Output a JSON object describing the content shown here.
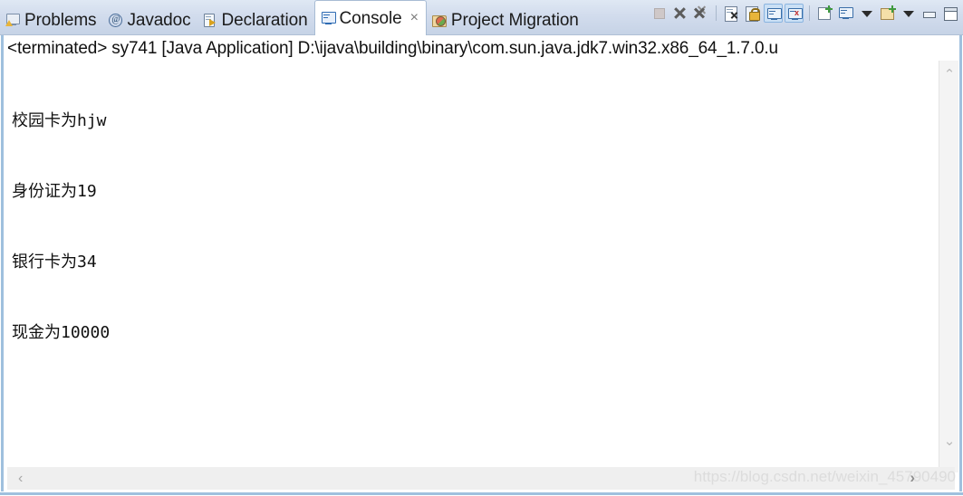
{
  "view": {
    "name": "Eclipse Console View"
  },
  "tabs": [
    {
      "label": "Problems",
      "icon": "problems-icon",
      "active": false,
      "closable": false
    },
    {
      "label": "Javadoc",
      "icon": "javadoc-icon",
      "active": false,
      "closable": false
    },
    {
      "label": "Declaration",
      "icon": "declaration-icon",
      "active": false,
      "closable": false
    },
    {
      "label": "Console",
      "icon": "console-icon",
      "active": true,
      "closable": true,
      "close_label": "×"
    },
    {
      "label": "Project Migration",
      "icon": "migration-icon",
      "active": false,
      "closable": false
    }
  ],
  "toolbar": {
    "buttons": [
      {
        "name": "terminate-button",
        "title": "Terminate",
        "enabled": false
      },
      {
        "name": "remove-launch-button",
        "title": "Remove Launch",
        "enabled": true
      },
      {
        "name": "remove-all-launches-button",
        "title": "Remove All Terminated",
        "enabled": true
      },
      {
        "name": "clear-console-button",
        "title": "Clear Console",
        "enabled": true
      },
      {
        "name": "scroll-lock-button",
        "title": "Scroll Lock",
        "enabled": true
      },
      {
        "name": "show-console-button",
        "title": "Show Console When Output Changes",
        "enabled": true,
        "toggled": true
      },
      {
        "name": "show-console-error-button",
        "title": "Show Console on Error",
        "enabled": true,
        "toggled": true
      },
      {
        "name": "new-console-view-button",
        "title": "Open Console",
        "enabled": true
      },
      {
        "name": "display-selected-console-button",
        "title": "Display Selected Console",
        "enabled": true
      },
      {
        "name": "display-console-dropdown",
        "title": "Display Selected Console Menu",
        "enabled": true
      },
      {
        "name": "open-console-button",
        "title": "Open Console",
        "enabled": true
      },
      {
        "name": "open-console-dropdown",
        "title": "Open Console Menu",
        "enabled": true
      },
      {
        "name": "minimize-view-button",
        "title": "Minimize",
        "enabled": true
      },
      {
        "name": "maximize-view-button",
        "title": "Maximize",
        "enabled": true
      }
    ]
  },
  "console": {
    "process_line": "<terminated> sy741 [Java Application] D:\\ijava\\building\\binary\\com.sun.java.jdk7.win32.x86_64_1.7.0.u",
    "output_lines": [
      "校园卡为hjw",
      "身份证为19",
      "银行卡为34",
      "现金为10000"
    ]
  },
  "scrollbars": {
    "vertical": {
      "up_glyph": "⌃",
      "down_glyph": "⌄"
    },
    "horizontal": {
      "left_glyph": "‹",
      "right_glyph": "›"
    }
  },
  "watermark": {
    "text": "https://blog.csdn.net/weixin_45790490"
  },
  "colors": {
    "tabbar_top": "#dfe8f4",
    "tabbar_bottom": "#c6d3e6",
    "active_tab_bg": "#ffffff",
    "border": "#9fc0de",
    "toggle_highlight": "#cbe0f5",
    "text": "#111111",
    "watermark": "#dcdcdc",
    "scrollbar_bg": "#f4f4f4"
  }
}
